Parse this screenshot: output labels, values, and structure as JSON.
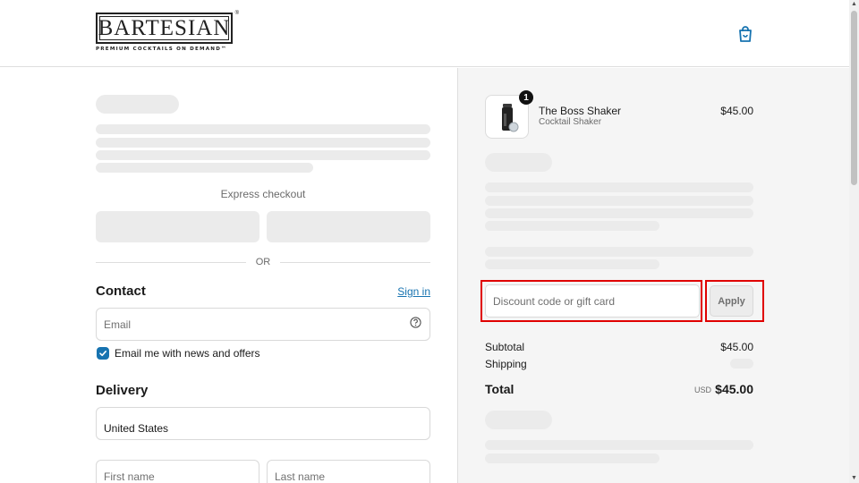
{
  "header": {
    "logo_word": "BARTESIAN",
    "logo_reg": "®",
    "logo_tagline": "PREMIUM COCKTAILS ON DEMAND™",
    "cart_icon": "shopping-bag-icon"
  },
  "express": {
    "label": "Express checkout",
    "or_text": "OR"
  },
  "contact": {
    "title": "Contact",
    "signin_label": "Sign in",
    "email_placeholder": "Email",
    "help_icon": "question-circle-icon",
    "marketing_checkbox_checked": true,
    "marketing_label": "Email me with news and offers"
  },
  "delivery": {
    "title": "Delivery",
    "country_value": "United States",
    "first_name_placeholder": "First name",
    "last_name_placeholder": "Last name"
  },
  "order": {
    "item": {
      "quantity": "1",
      "name": "The Boss Shaker",
      "variant": "Cocktail Shaker",
      "price": "$45.00"
    },
    "discount_placeholder": "Discount code or gift card",
    "apply_label": "Apply",
    "subtotal_label": "Subtotal",
    "subtotal_value": "$45.00",
    "shipping_label": "Shipping",
    "total_label": "Total",
    "total_currency": "USD",
    "total_value": "$45.00"
  },
  "colors": {
    "link": "#1773b0",
    "highlight": "#e00000",
    "summary_bg": "#f5f5f5"
  }
}
